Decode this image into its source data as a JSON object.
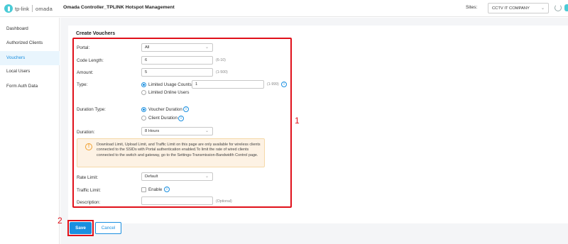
{
  "header": {
    "brand_tplink": "tp-link",
    "brand_omada": "omada",
    "app_title": "Omada Controller_TPLINK Hotspot Management",
    "sites_label": "Sites:",
    "site_selected": "CCTV IT COMPANY"
  },
  "sidebar": {
    "items": [
      {
        "label": "Dashboard"
      },
      {
        "label": "Authorized Clients"
      },
      {
        "label": "Vouchers",
        "active": true
      },
      {
        "label": "Local Users"
      },
      {
        "label": "Form Auth Data"
      }
    ]
  },
  "form": {
    "title": "Create Vouchers",
    "portal": {
      "label": "Portal:",
      "value": "All"
    },
    "code_length": {
      "label": "Code Length:",
      "value": "6",
      "hint": "(6-10)"
    },
    "amount": {
      "label": "Amount:",
      "value": "5",
      "hint": "(1-500)"
    },
    "type": {
      "label": "Type:",
      "options": [
        "Limited Usage Counts",
        "Limited Online Users"
      ],
      "selected": "Limited Usage Counts",
      "count_value": "1",
      "count_hint": "(1-999)"
    },
    "duration_type": {
      "label": "Duration Type:",
      "options": [
        "Voucher Duration",
        "Client Duration"
      ],
      "selected": "Voucher Duration"
    },
    "duration": {
      "label": "Duration:",
      "value": "8 Hours"
    },
    "notice": "Download Limit, Upload Limit, and Traffic Limit on this page are only available for wireless clients connected to the SSIDs with Portal authentication enabled.To limit the rate of wired clients connected to the switch and gateway, go to the Settings-Transmission-Bandwidth Control page.",
    "rate_limit": {
      "label": "Rate Limit:",
      "value": "Default"
    },
    "traffic_limit": {
      "label": "Traffic Limit:",
      "checkbox_label": "Enable",
      "checked": false
    },
    "description": {
      "label": "Description:",
      "value": "",
      "hint": "(Optional)"
    }
  },
  "actions": {
    "save": "Save",
    "cancel": "Cancel"
  },
  "annotations": {
    "marker1": "1",
    "marker2": "2"
  },
  "colors": {
    "accent": "#1a8fe0",
    "highlight": "#e0101a",
    "notice_bg": "#fdf2e4"
  }
}
